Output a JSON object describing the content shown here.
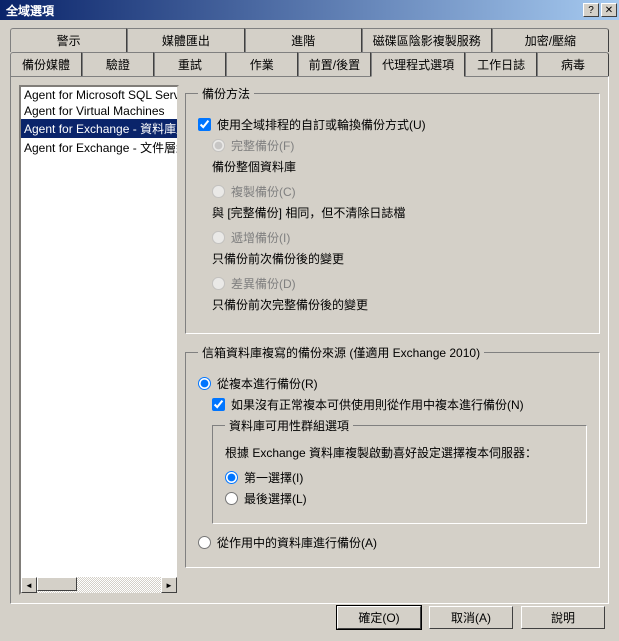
{
  "window": {
    "title": "全域選項"
  },
  "tabs_row1": [
    {
      "label": "警示"
    },
    {
      "label": "媒體匯出"
    },
    {
      "label": "進階"
    },
    {
      "label": "磁碟區陰影複製服務"
    },
    {
      "label": "加密/壓縮"
    }
  ],
  "tabs_row2": [
    {
      "label": "備份媒體"
    },
    {
      "label": "驗證"
    },
    {
      "label": "重試"
    },
    {
      "label": "作業"
    },
    {
      "label": "前置/後置"
    },
    {
      "label": "代理程式選項",
      "active": true
    },
    {
      "label": "工作日誌"
    },
    {
      "label": "病毒"
    }
  ],
  "agents": [
    {
      "label": "Agent for Microsoft SQL Server"
    },
    {
      "label": "Agent for Virtual Machines"
    },
    {
      "label": "Agent for Exchange - 資料庫層",
      "selected": true
    },
    {
      "label": "Agent for Exchange - 文件層級"
    }
  ],
  "fs_method": {
    "legend": "備份方法",
    "use_global": "使用全域排程的自訂或輪換備份方式(U)",
    "full": "完整備份(F)",
    "full_desc": "備份整個資料庫",
    "copy": "複製備份(C)",
    "copy_desc": "與 [完整備份] 相同，但不清除日誌檔",
    "incr": "遞增備份(I)",
    "incr_desc": "只備份前次備份後的變更",
    "diff": "差異備份(D)",
    "diff_desc": "只備份前次完整備份後的變更"
  },
  "fs_repl": {
    "legend": "信箱資料庫複寫的備份來源 (僅適用 Exchange 2010)",
    "from_replica": "從複本進行備份(R)",
    "fallback_active": "如果沒有正常複本可供使用則從作用中複本進行備份(N)",
    "dag_legend": "資料庫可用性群組選項",
    "dag_desc": "根據 Exchange 資料庫複製啟動喜好設定選擇複本伺服器：",
    "first": "第一選擇(I)",
    "last": "最後選擇(L)",
    "from_active": "從作用中的資料庫進行備份(A)"
  },
  "buttons": {
    "ok": "確定(O)",
    "cancel": "取消(A)",
    "help": "說明"
  }
}
